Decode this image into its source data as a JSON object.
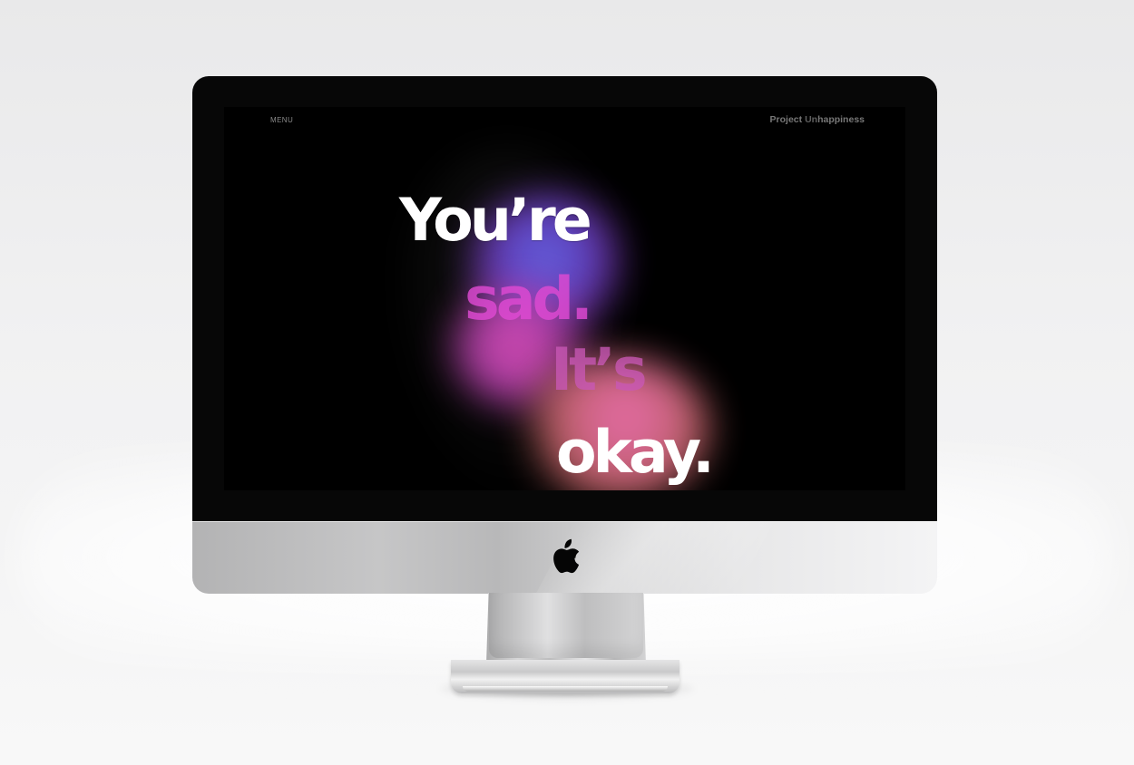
{
  "page": {
    "menu_label": "MENU",
    "brand": {
      "prefix": "Project ",
      "highlight": "Un",
      "suffix": "happiness"
    },
    "hero": {
      "line1": "You’re",
      "line2": "sad.",
      "line3": "It’s",
      "line4": "okay."
    }
  },
  "colors": {
    "screen_background": "#000000",
    "menu_text": "#8a8a8a",
    "brand_text": "#777777",
    "hero_white": "#ffffff",
    "hero_pink": "#df4ad3",
    "gradient_blue": "#6f68e8",
    "gradient_coral": "#d96a8b"
  },
  "icons": {
    "device_logo": "apple-logo-icon"
  }
}
